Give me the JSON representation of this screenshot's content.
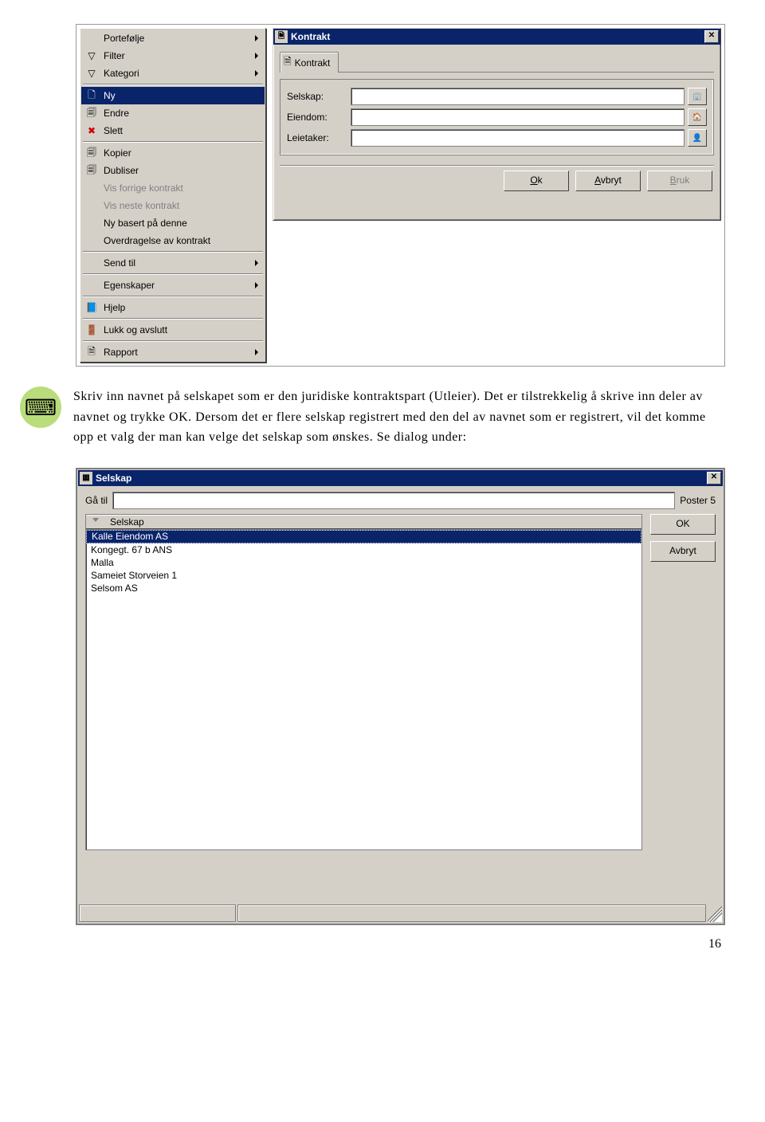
{
  "menu": {
    "groups": [
      [
        {
          "icon": "",
          "label": "Portefølje",
          "arrow": true
        },
        {
          "icon": "▽",
          "label": "Filter",
          "arrow": true
        },
        {
          "icon": "▽",
          "label": "Kategori",
          "arrow": true
        }
      ],
      [
        {
          "icon": "🗋",
          "label": "Ny",
          "selected": true
        },
        {
          "icon": "🗐",
          "label": "Endre"
        },
        {
          "icon": "✖",
          "label": "Slett",
          "iconColor": "#c00"
        }
      ],
      [
        {
          "icon": "🗐",
          "label": "Kopier"
        },
        {
          "icon": "🗐",
          "label": "Dubliser"
        },
        {
          "icon": "",
          "label": "Vis forrige kontrakt",
          "disabled": true
        },
        {
          "icon": "",
          "label": "Vis neste kontrakt",
          "disabled": true
        },
        {
          "icon": "",
          "label": "Ny basert på denne"
        },
        {
          "icon": "",
          "label": "Overdragelse av kontrakt"
        }
      ],
      [
        {
          "icon": "",
          "label": "Send til",
          "arrow": true
        }
      ],
      [
        {
          "icon": "",
          "label": "Egenskaper",
          "arrow": true
        }
      ],
      [
        {
          "icon": "📘",
          "label": "Hjelp"
        }
      ],
      [
        {
          "icon": "🚪",
          "label": "Lukk og avslutt"
        }
      ],
      [
        {
          "icon": "🗎",
          "label": "Rapport",
          "arrow": true
        }
      ]
    ]
  },
  "kontrakt_dialog": {
    "title": "Kontrakt",
    "tab": "Kontrakt",
    "fields": {
      "selskap": "Selskap:",
      "eiendom": "Eiendom:",
      "leietaker": "Leietaker:"
    },
    "ok": "Ok",
    "avbryt": "Avbryt",
    "bruk": "Bruk"
  },
  "body_text": "Skriv inn navnet på selskapet som er den juridiske kontraktspart (Utleier). Det er tilstrekkelig å skrive inn deler av navnet og trykke OK. Dersom det er flere selskap registrert med den del av navnet som er registrert, vil det komme opp et valg der man kan velge det selskap som ønskes. Se dialog under:",
  "selskap_dialog": {
    "title": "Selskap",
    "goto": "Gå til",
    "poster": "Poster 5",
    "header": "Selskap",
    "rows": [
      "Kalle Eiendom AS",
      "Kongegt. 67 b ANS",
      "Malla",
      "Sameiet Storveien 1",
      "Selsom AS"
    ],
    "ok": "OK",
    "avbryt": "Avbryt"
  },
  "page_number": "16"
}
